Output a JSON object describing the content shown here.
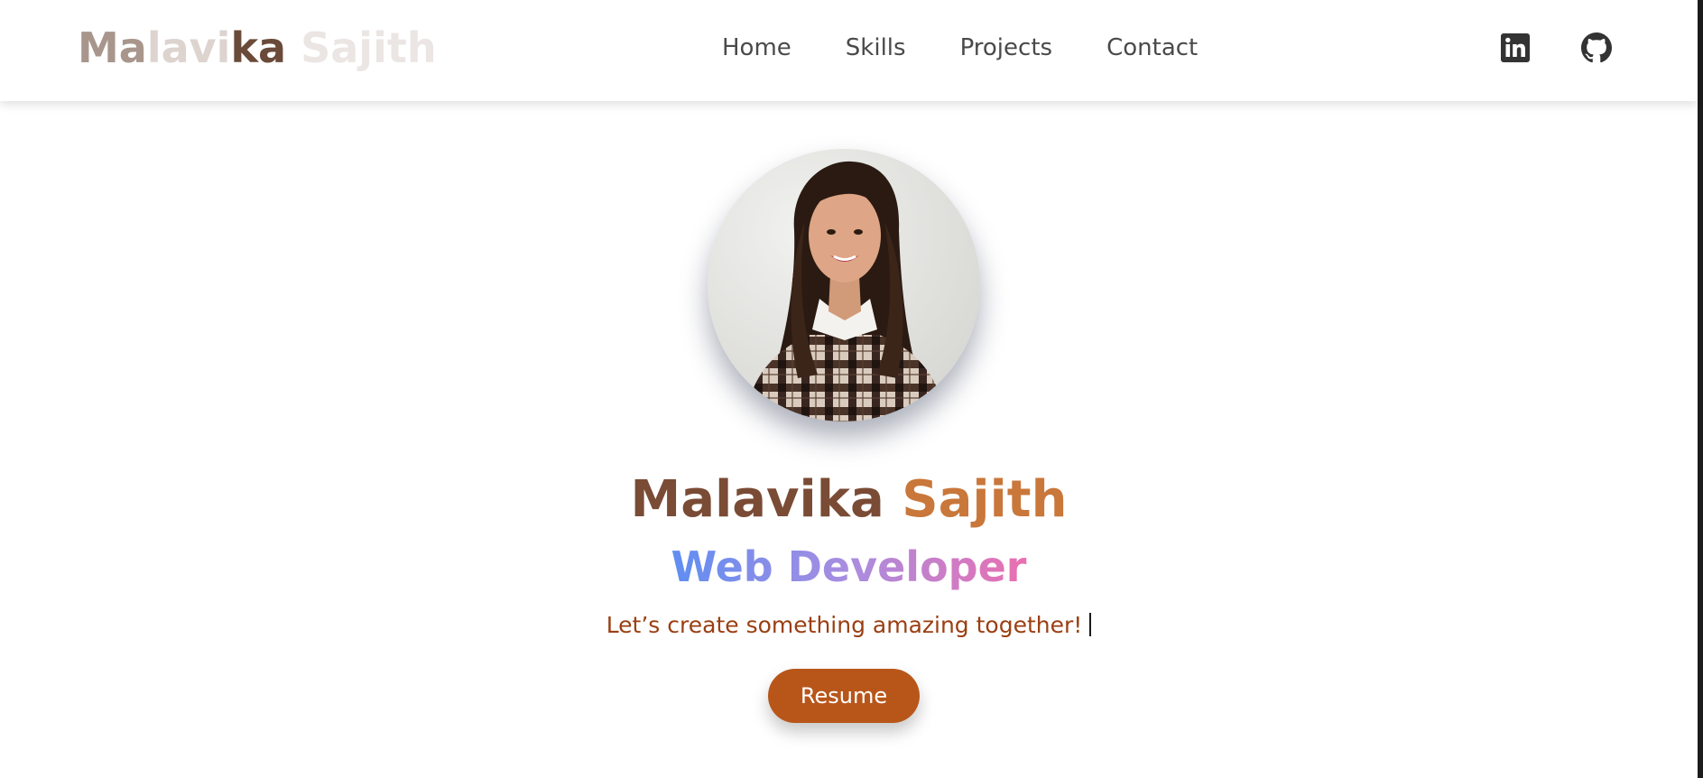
{
  "header": {
    "logo_chars": [
      {
        "ch": "M",
        "color": "#a8968c"
      },
      {
        "ch": "a",
        "color": "#a8968c"
      },
      {
        "ch": "l",
        "color": "#ddd3cf"
      },
      {
        "ch": "a",
        "color": "#ddd3cf"
      },
      {
        "ch": "v",
        "color": "#ddd3cf"
      },
      {
        "ch": "i",
        "color": "#ddd3cf"
      },
      {
        "ch": "k",
        "color": "#6a4a38"
      },
      {
        "ch": "a",
        "color": "#6a4a38"
      },
      {
        "ch": " ",
        "color": "#ffffff"
      },
      {
        "ch": "S",
        "color": "#ebe6e4"
      },
      {
        "ch": "a",
        "color": "#ebe6e4"
      },
      {
        "ch": "j",
        "color": "#ebe6e4"
      },
      {
        "ch": "i",
        "color": "#ebe6e4"
      },
      {
        "ch": "t",
        "color": "#ebe6e4"
      },
      {
        "ch": "h",
        "color": "#ebe6e4"
      }
    ],
    "nav": [
      {
        "label": "Home",
        "name": "nav-home"
      },
      {
        "label": "Skills",
        "name": "nav-skills"
      },
      {
        "label": "Projects",
        "name": "nav-projects"
      },
      {
        "label": "Contact",
        "name": "nav-contact"
      }
    ],
    "social_icons": [
      "linkedin-icon",
      "github-icon"
    ]
  },
  "hero": {
    "name_first": "Malavika",
    "name_last": "Sajith",
    "role": "Web Developer",
    "tagline": "Let’s create something amazing together!",
    "resume_label": "Resume"
  },
  "colors": {
    "accent": "#b8561a",
    "name_first": "#7a4b35",
    "name_last": "#c9773a",
    "role_gradient": [
      "#5f8ef2",
      "#a98de0",
      "#ea6fb0"
    ],
    "tagline": "#9a3f12"
  }
}
